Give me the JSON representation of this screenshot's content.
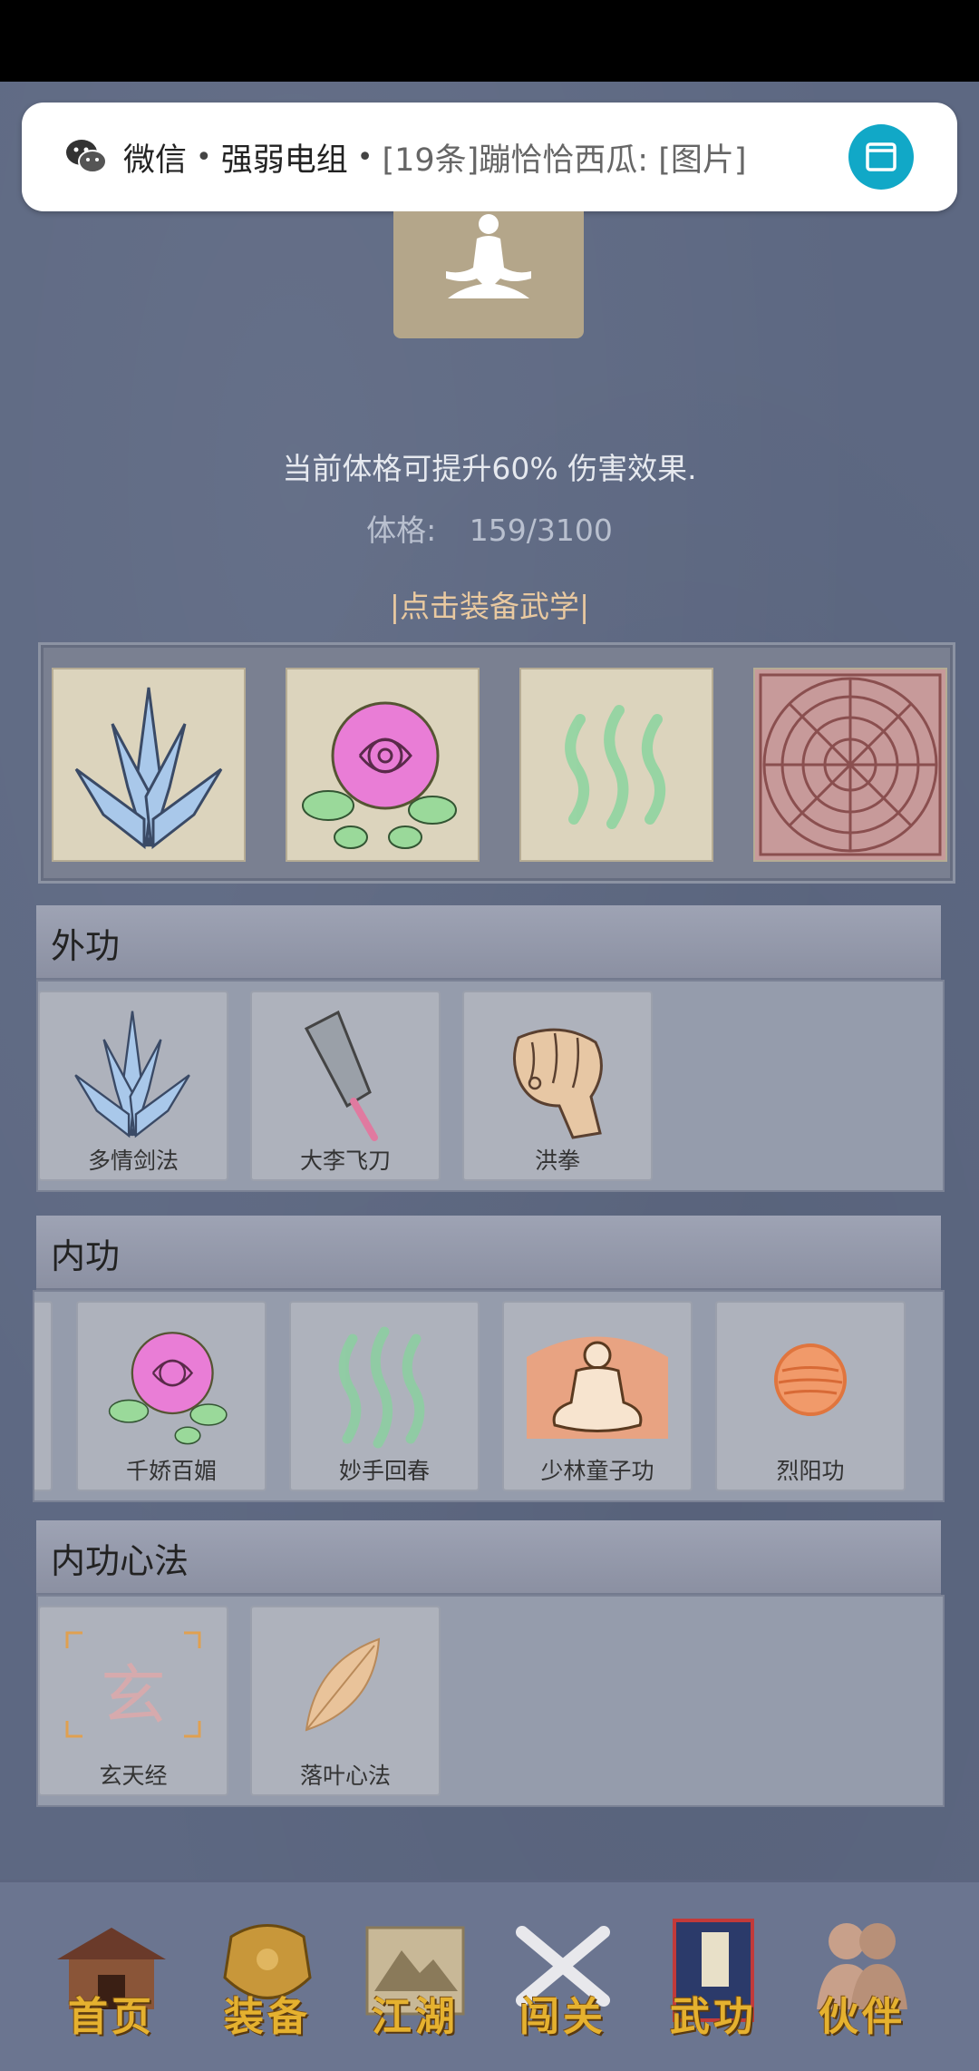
{
  "notification": {
    "app": "微信",
    "group": "强弱电组",
    "message": "[19条]蹦恰恰西瓜: [图片]",
    "open_icon": "window-icon"
  },
  "header": {
    "info_line": "当前体格可提升60% 伤害效果.",
    "stat_label": "体格:",
    "stat_value": "159/3100",
    "equip_link": "|点击装备武学|"
  },
  "equipped_slots": [
    {
      "icon": "sword-fan-icon"
    },
    {
      "icon": "rose-icon"
    },
    {
      "icon": "green-waves-icon"
    },
    {
      "icon": "aztec-calendar-icon"
    }
  ],
  "sections": {
    "outer": {
      "title": "外功",
      "items": [
        "多情剑法",
        "大李飞刀",
        "洪拳"
      ]
    },
    "inner": {
      "title": "内功",
      "items": [
        "千娇百媚",
        "妙手回春",
        "少林童子功",
        "烈阳功"
      ]
    },
    "heart": {
      "title": "内功心法",
      "items": [
        "玄天经",
        "落叶心法"
      ],
      "glyph": "玄"
    }
  },
  "nav": {
    "items": [
      {
        "label": "首页",
        "icon": "temple-icon"
      },
      {
        "label": "装备",
        "icon": "armor-icon"
      },
      {
        "label": "江湖",
        "icon": "scroll-map-icon"
      },
      {
        "label": "闯关",
        "icon": "crossed-swords-icon"
      },
      {
        "label": "武功",
        "icon": "book-icon"
      },
      {
        "label": "伙伴",
        "icon": "companions-icon"
      }
    ]
  },
  "colors": {
    "background": "#5d6882",
    "accent_gold": "#e5b12f",
    "wechat_button": "#11a8c7"
  }
}
